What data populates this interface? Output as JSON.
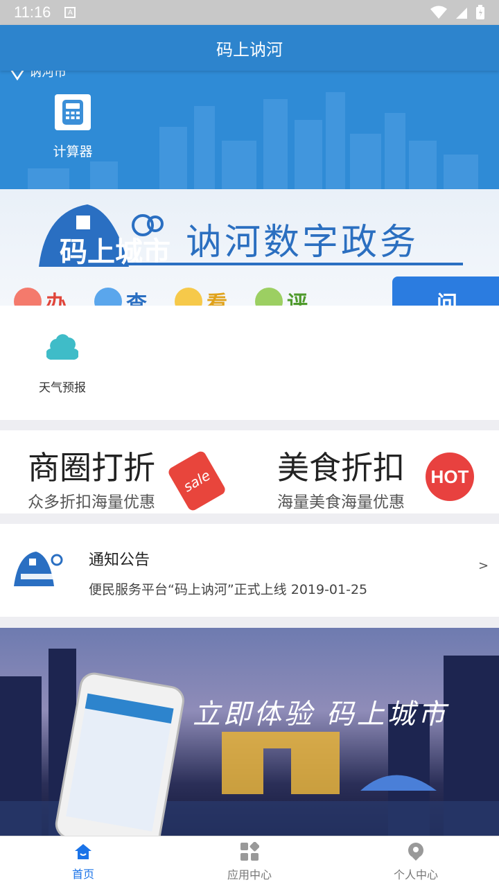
{
  "status_bar": {
    "time": "11:16",
    "notification_glyph": "A"
  },
  "app_bar": {
    "title": "码上讷河"
  },
  "hero": {
    "location": "讷河市",
    "tool": {
      "label": "计算器",
      "icon": "calculator-icon"
    }
  },
  "banner": {
    "logo_text": "码上城市",
    "title": "讷河数字政务",
    "actions": [
      "办",
      "查",
      "看",
      "评",
      "问"
    ]
  },
  "services": [
    {
      "label": "天气预报",
      "icon": "cloud-icon"
    }
  ],
  "promos": [
    {
      "title": "商圈打折",
      "subtitle": "众多折扣海量优惠",
      "badge": "sale"
    },
    {
      "title": "美食折扣",
      "subtitle": "海量美食海量优惠",
      "badge": "HOT"
    }
  ],
  "notice": {
    "title": "通知公告",
    "text": "便民服务平台“码上讷河”正式上线 2019-01-25",
    "arrow": ">"
  },
  "promo_banner": {
    "text": "立即体验  码上城市"
  },
  "tabs": [
    {
      "label": "首页",
      "icon": "home-icon",
      "active": true
    },
    {
      "label": "应用中心",
      "icon": "apps-icon",
      "active": false
    },
    {
      "label": "个人中心",
      "icon": "user-icon",
      "active": false
    }
  ],
  "colors": {
    "primary": "#2d84cd",
    "active_tab": "#1a73e8",
    "hot": "#e8413f"
  }
}
